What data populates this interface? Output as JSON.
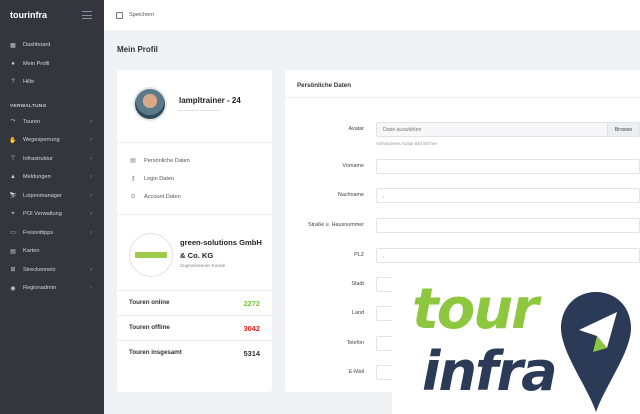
{
  "app": {
    "brand": "tourinfra"
  },
  "sidebar": {
    "top_items": [
      {
        "label": "Dashboard",
        "icon": "dashboard-icon"
      },
      {
        "label": "Mein Profil",
        "icon": "user-icon"
      },
      {
        "label": "Hilfe",
        "icon": "help-icon"
      }
    ],
    "section_label": "VERWALTUNG",
    "admin_items": [
      {
        "label": "Touren",
        "icon": "route-icon"
      },
      {
        "label": "Wegesperrung",
        "icon": "barrier-icon"
      },
      {
        "label": "Infrastruktur",
        "icon": "signpost-icon"
      },
      {
        "label": "Meldungen",
        "icon": "alert-icon"
      },
      {
        "label": "Loipenmanager",
        "icon": "ski-icon"
      },
      {
        "label": "POI Verwaltung",
        "icon": "pin-icon"
      },
      {
        "label": "Freizeittipps",
        "icon": "ticket-icon"
      },
      {
        "label": "Karten",
        "icon": "map-icon"
      },
      {
        "label": "Streckennetz",
        "icon": "network-icon"
      },
      {
        "label": "Regionadmin",
        "icon": "globe-icon"
      }
    ]
  },
  "topbar": {
    "save_label": "Speichern"
  },
  "page": {
    "title": "Mein Profil"
  },
  "profile": {
    "username": "lampltrainer - 24",
    "menu": [
      {
        "label": "Persönliche Daten",
        "icon": "id-card-icon"
      },
      {
        "label": "Login Daten",
        "icon": "key-icon"
      },
      {
        "label": "Account Daten",
        "icon": "account-icon"
      }
    ],
    "company_name": "green-solutions GmbH & Co. KG",
    "company_role": "Zugewiesener Kunde",
    "stats": [
      {
        "label": "Touren online",
        "value": "2272",
        "color": "#7cc43b"
      },
      {
        "label": "Touren offline",
        "value": "3042",
        "color": "#e02020"
      },
      {
        "label": "Touren insgesamt",
        "value": "5314",
        "color": "#333333"
      }
    ]
  },
  "personal": {
    "header": "Persönliche Daten",
    "avatar_label": "Avatar",
    "avatar_placeholder": "Datei auswählen",
    "browse_label": "Browse",
    "avatar_help": "Vorhandenes Avatar Bild löschen",
    "fields": [
      {
        "label": "Vorname",
        "value": ""
      },
      {
        "label": "Nachname",
        "value": ","
      },
      {
        "label": "Straße u. Hausnummer",
        "value": ""
      },
      {
        "label": "PLZ",
        "value": ","
      },
      {
        "label": "Stadt",
        "value": ""
      },
      {
        "label": "Land",
        "value": ""
      },
      {
        "label": "Telefon",
        "value": ""
      },
      {
        "label": "E-Mail",
        "value": ""
      }
    ]
  },
  "logo": {
    "line1": "tour",
    "line2": "infra",
    "colors": {
      "green": "#8dc63f",
      "navy": "#2b3a57"
    }
  }
}
